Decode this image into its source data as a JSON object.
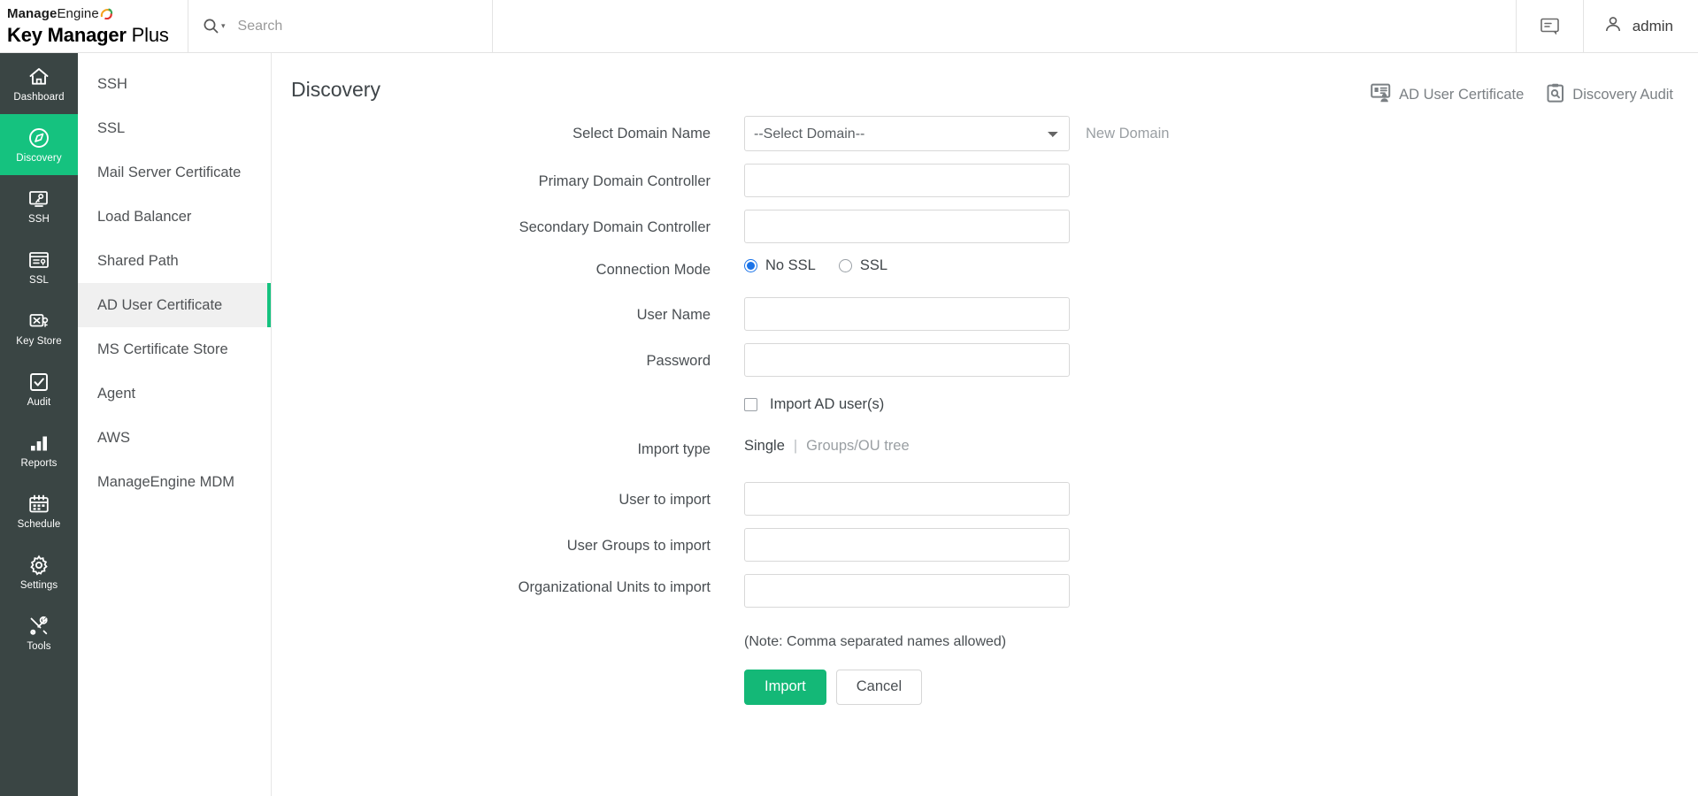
{
  "brand": {
    "line1_bold": "Manage",
    "line1_light": "Engine",
    "line2_bold": "Key Manager",
    "line2_light": " Plus"
  },
  "search": {
    "placeholder": "Search",
    "value": "",
    "icon": "search-icon",
    "caret_icon": "chevron-down-icon"
  },
  "topbar": {
    "notification_icon": "announcement-icon",
    "user_icon": "user-avatar-icon",
    "user_label": "admin"
  },
  "nav": {
    "items": [
      {
        "label": "Dashboard",
        "icon": "home-icon",
        "active": false
      },
      {
        "label": "Discovery",
        "icon": "compass-icon",
        "active": true
      },
      {
        "label": "SSH",
        "icon": "ssh-terminal-icon",
        "active": false
      },
      {
        "label": "SSL",
        "icon": "ssl-certificate-icon",
        "active": false
      },
      {
        "label": "Key Store",
        "icon": "key-store-icon",
        "active": false
      },
      {
        "label": "Audit",
        "icon": "checkbox-audit-icon",
        "active": false
      },
      {
        "label": "Reports",
        "icon": "bar-chart-icon",
        "active": false
      },
      {
        "label": "Schedule",
        "icon": "calendar-icon",
        "active": false
      },
      {
        "label": "Settings",
        "icon": "gear-icon",
        "active": false
      },
      {
        "label": "Tools",
        "icon": "tools-icon",
        "active": false
      }
    ]
  },
  "subnav": {
    "items": [
      {
        "label": "SSH",
        "active": false
      },
      {
        "label": "SSL",
        "active": false
      },
      {
        "label": "Mail Server Certificate",
        "active": false
      },
      {
        "label": "Load Balancer",
        "active": false
      },
      {
        "label": "Shared Path",
        "active": false
      },
      {
        "label": "AD User Certificate",
        "active": true
      },
      {
        "label": "MS Certificate Store",
        "active": false
      },
      {
        "label": "Agent",
        "active": false
      },
      {
        "label": "AWS",
        "active": false
      },
      {
        "label": "ManageEngine MDM",
        "active": false
      }
    ]
  },
  "page": {
    "title": "Discovery",
    "head_links": [
      {
        "label": "AD User Certificate",
        "icon": "ad-user-certificate-icon"
      },
      {
        "label": "Discovery Audit",
        "icon": "clipboard-search-icon"
      }
    ]
  },
  "form": {
    "domain": {
      "label": "Select Domain Name",
      "selected": "--Select Domain--",
      "options": [
        "--Select Domain--"
      ],
      "side_link": "New Domain"
    },
    "primary_dc": {
      "label": "Primary Domain Controller",
      "value": "",
      "placeholder": ""
    },
    "secondary_dc": {
      "label": "Secondary Domain Controller",
      "value": "",
      "placeholder": ""
    },
    "connection_mode": {
      "label": "Connection Mode",
      "options": [
        {
          "label": "No SSL",
          "selected": true
        },
        {
          "label": "SSL",
          "selected": false
        }
      ]
    },
    "user_name": {
      "label": "User Name",
      "value": "",
      "placeholder": ""
    },
    "password": {
      "label": "Password",
      "value": "",
      "placeholder": ""
    },
    "import_ad_users": {
      "label": "Import AD user(s)",
      "checked": false
    },
    "import_type": {
      "label": "Import type",
      "active": "Single",
      "separator": "|",
      "inactive": "Groups/OU tree"
    },
    "user_to_import": {
      "label": "User to import",
      "value": "",
      "placeholder": ""
    },
    "user_groups_to_import": {
      "label": "User Groups to import",
      "value": "",
      "placeholder": ""
    },
    "org_units_to_import": {
      "label": "Organizational Units to import",
      "value": "",
      "placeholder": ""
    },
    "note": "(Note: Comma separated names allowed)",
    "buttons": {
      "submit": "Import",
      "cancel": "Cancel"
    }
  },
  "colors": {
    "accent_green": "#15c27f",
    "nav_dark": "#3a4544",
    "button_green": "#14b877",
    "radio_blue": "#1a73e8"
  }
}
